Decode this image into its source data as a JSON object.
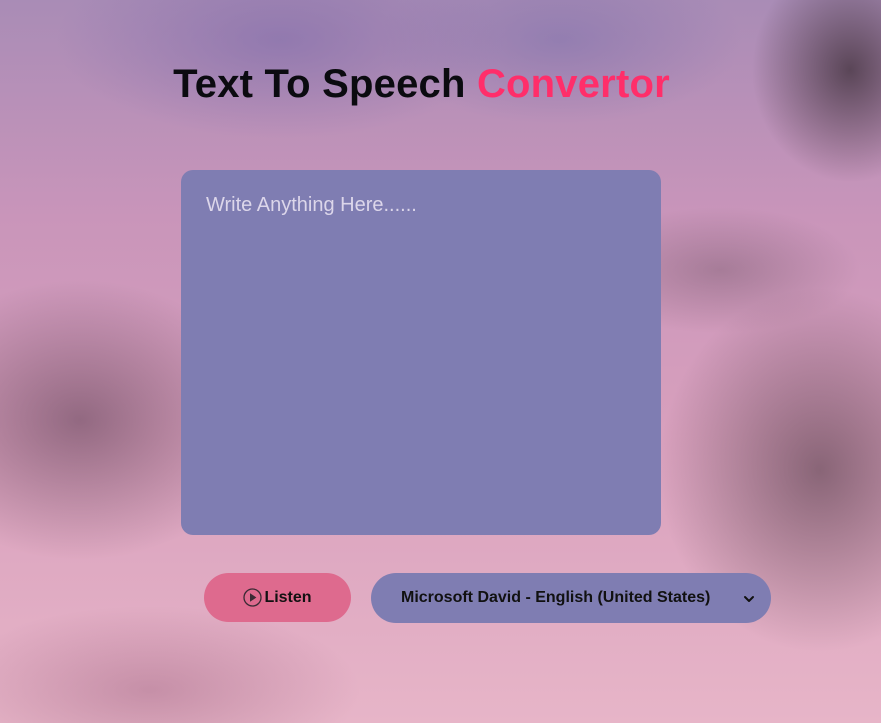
{
  "header": {
    "title_main": "Text To Speech ",
    "title_accent": "Convertor"
  },
  "editor": {
    "placeholder": "Write Anything Here......",
    "value": ""
  },
  "controls": {
    "listen_label": "Listen",
    "voice_selected": "Microsoft David - English (United States)"
  },
  "icons": {
    "listen": "play-circle-icon",
    "voice_dropdown": "chevron-down-icon"
  },
  "colors": {
    "accent": "#ff2e6a",
    "panel": "#7f7db2",
    "button": "#de6a8e"
  }
}
